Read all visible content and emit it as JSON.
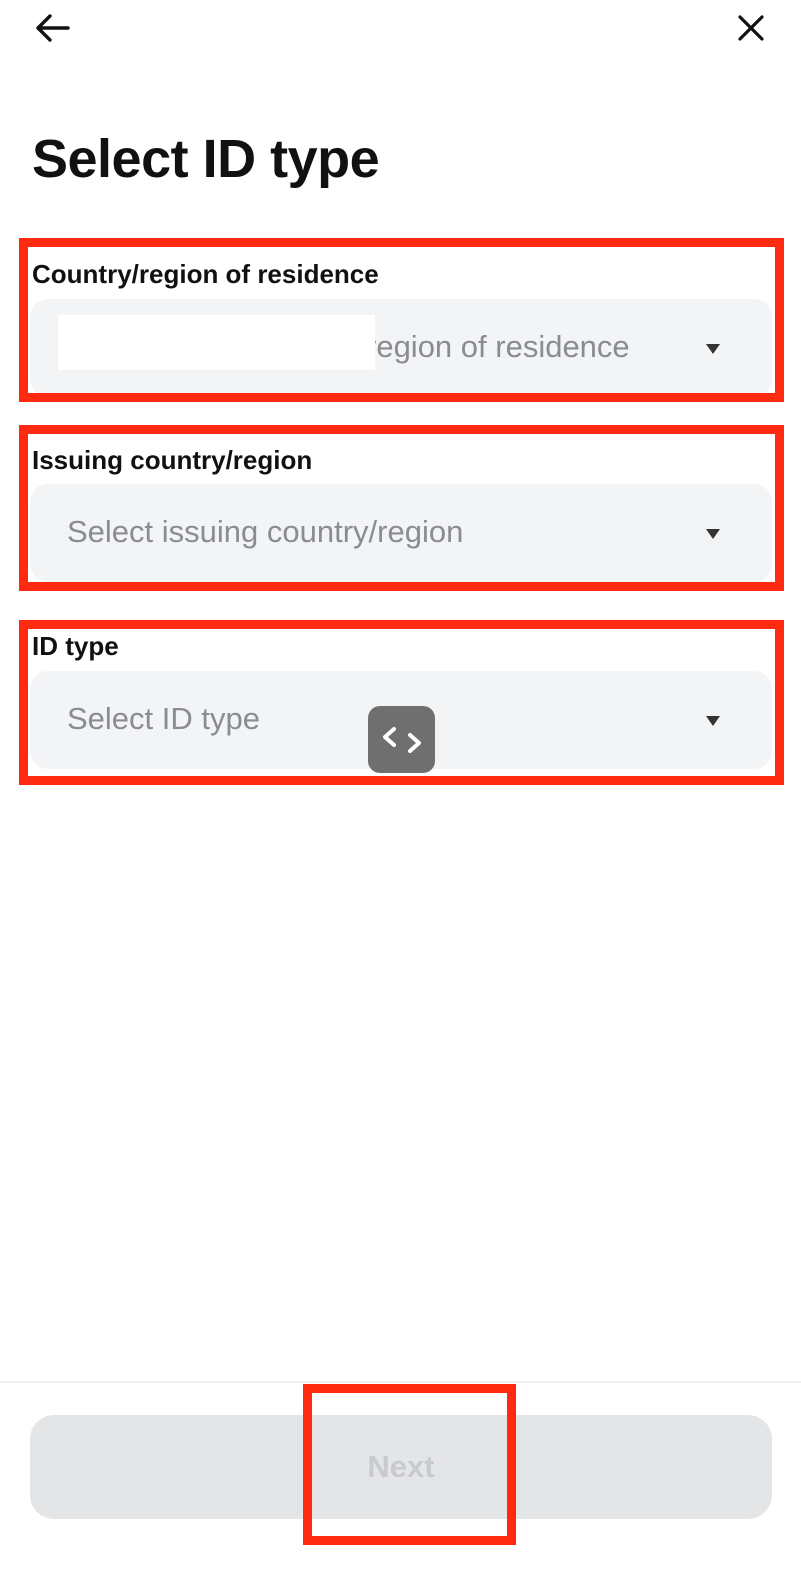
{
  "header": {
    "back_icon": "arrow-left-icon",
    "close_icon": "close-icon"
  },
  "page": {
    "title": "Select ID type"
  },
  "fields": [
    {
      "label": "Country/region of residence",
      "placeholder": "region of residence",
      "icon": "caret-down-icon"
    },
    {
      "label": "Issuing country/region",
      "placeholder": "Select issuing country/region",
      "icon": "caret-down-icon"
    },
    {
      "label": "ID type",
      "placeholder": "Select ID type",
      "icon": "caret-down-icon"
    }
  ],
  "floating_button": {
    "icon": "code-swap-icon"
  },
  "footer": {
    "next_label": "Next"
  },
  "colors": {
    "annotation": "#ff2a0f",
    "field_bg": "#f3f4f6",
    "placeholder": "#8a8c90",
    "disabled_button_bg": "#e4e5e7",
    "disabled_button_text": "#c8cacd"
  }
}
